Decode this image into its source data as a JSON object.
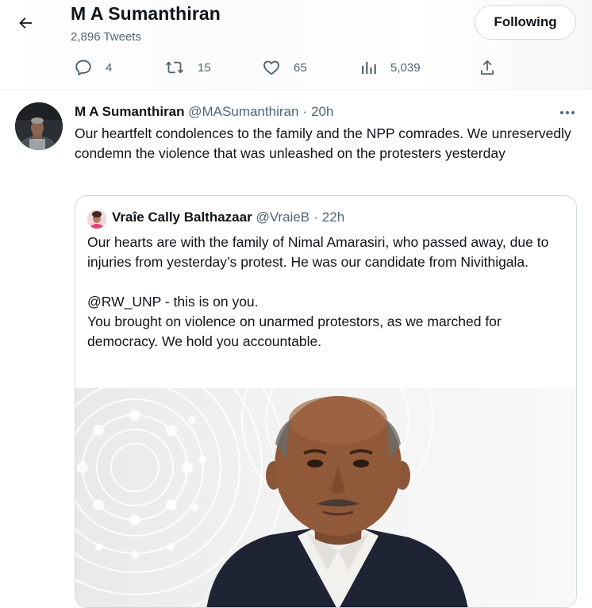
{
  "header": {
    "profile_name": "M A Sumanthiran",
    "tweet_count": "2,896 Tweets",
    "follow_label": "Following",
    "actions": {
      "replies": "4",
      "retweets": "15",
      "likes": "65",
      "views": "5,039"
    }
  },
  "tweet": {
    "author_name": "M A Sumanthiran",
    "author_handle": "@MASumanthiran",
    "time_ago": "20h",
    "text": "Our heartfelt condolences to the family and the NPP comrades. We unreservedly condemn the violence that was unleashed on the protesters yesterday"
  },
  "quoted_tweet": {
    "author_name": "Vraîe Cally Balthazaar",
    "author_handle": "@VraieB",
    "time_ago": "22h",
    "paragraph_1": "Our hearts are with the family of Nimal Amarasiri, who passed away, due to injuries from yesterday’s protest. He was our candidate from Nivithigala.",
    "line_2": "@RW_UNP - this is on you.",
    "line_3": "You brought on violence on unarmed protestors, as we marched for democracy. We hold you accountable."
  },
  "separator": "·",
  "icons": {
    "back": "arrow-left-icon",
    "reply": "reply-icon",
    "retweet": "retweet-icon",
    "like": "heart-icon",
    "views": "views-icon",
    "share": "share-icon",
    "more": "more-icon"
  },
  "colors": {
    "text_primary": "#0f1419",
    "text_secondary": "#536471",
    "border": "#cfd9de"
  }
}
